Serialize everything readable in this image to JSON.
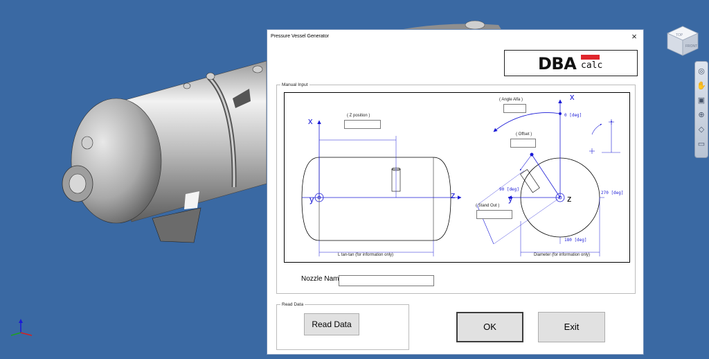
{
  "dialog": {
    "title": "Pressure Vessel Generator",
    "close_glyph": "×",
    "logo": {
      "main": "DBA",
      "sub": "calc",
      "accent_color": "#e0262c"
    }
  },
  "manual_input": {
    "label": "Manual Input",
    "side_view": {
      "axis_x": "x",
      "axis_y": "y",
      "axis_z": "z",
      "z_position_label": "( Z position )",
      "length_label": "L tan-tan (for information only)"
    },
    "end_view": {
      "axis_x": "x",
      "axis_y": "y",
      "axis_z": "z",
      "angle_label": "( Angle Alfa )",
      "offset_label": "( Offset )",
      "standout_label": "( Stand Out )",
      "deg_0": "0 [deg]",
      "deg_90": "90 [deg]",
      "deg_180": "180 [deg]",
      "deg_270": "270 [deg]",
      "diameter_label": "Diameter (for information only)"
    },
    "nozzle_name_label": "Nozzle Name:",
    "nozzle_name_value": ""
  },
  "read_data": {
    "label": "Read Data",
    "button_label": "Read Data"
  },
  "buttons": {
    "ok": "OK",
    "exit": "Exit"
  },
  "viewcube": {
    "top": "TOP",
    "front": "FRONT"
  },
  "colors": {
    "background": "#3a69a3",
    "dimension_blue": "#1a1ad6"
  }
}
